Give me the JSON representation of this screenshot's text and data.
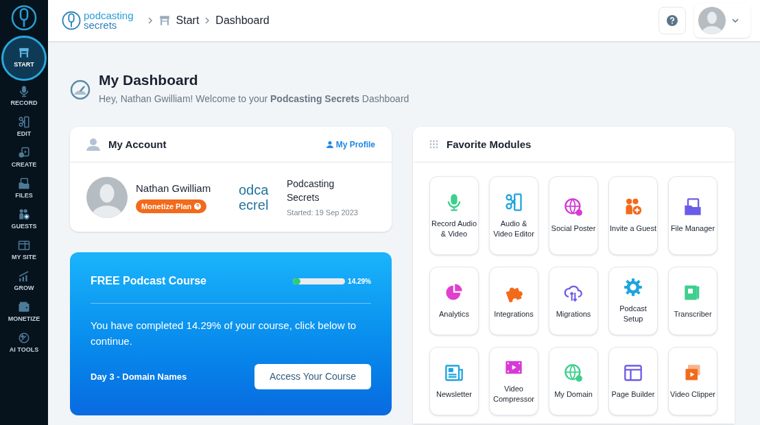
{
  "sidebar": {
    "items": [
      {
        "label": "START",
        "kind": "start",
        "selected": true
      },
      {
        "label": "RECORD",
        "kind": "mic",
        "selected": false
      },
      {
        "label": "EDIT",
        "kind": "edit",
        "selected": false
      },
      {
        "label": "CREATE",
        "kind": "create",
        "selected": false
      },
      {
        "label": "FILES",
        "kind": "files",
        "selected": false
      },
      {
        "label": "GUESTS",
        "kind": "guests",
        "selected": false
      },
      {
        "label": "MY SITE",
        "kind": "site",
        "selected": false
      },
      {
        "label": "GROW",
        "kind": "grow",
        "selected": false
      },
      {
        "label": "MONETIZE",
        "kind": "wallet",
        "selected": false
      },
      {
        "label": "AI TOOLS",
        "kind": "ai",
        "selected": false
      }
    ]
  },
  "header": {
    "logo": [
      "podcasting",
      "secrets"
    ],
    "breadcrumbs": [
      "Start",
      "Dashboard"
    ]
  },
  "page": {
    "title": "My Dashboard",
    "subtitle": "Hey, Nathan Gwilliam! Welcome to your **Podcasting Secrets** Dashboard"
  },
  "account": {
    "title": "My Account",
    "profile_link": "My Profile",
    "name": "Nathan Gwilliam",
    "plan": "Monetize Plan",
    "cover_text": [
      "odca",
      "ecrel"
    ],
    "podcast": "Podcasting Secrets",
    "started": "Started: 19 Sep 2023"
  },
  "course": {
    "title": "FREE Podcast Course",
    "level": 0.1429,
    "reading": "14.29%",
    "message": "You have completed 14.29% of your course, click below to continue.",
    "lesson": "Day 3 - Domain Names",
    "button": "Access Your Course"
  },
  "favorites": {
    "title": "Favorite Modules",
    "modules": [
      {
        "label": "Record Audio & Video",
        "kind": "mic",
        "color": "#3ecf8e"
      },
      {
        "label": "Audio & Video Editor",
        "kind": "edit",
        "color": "#1ea4e0"
      },
      {
        "label": "Social Poster",
        "kind": "globe",
        "color": "#d63ad6"
      },
      {
        "label": "Invite a Guest",
        "kind": "guests",
        "color": "#f26a1b"
      },
      {
        "label": "File Manager",
        "kind": "files",
        "color": "#6b5ce7"
      },
      {
        "label": "Analytics",
        "kind": "pie",
        "color": "#e23fd0"
      },
      {
        "label": "Integrations",
        "kind": "puzzle",
        "color": "#f26a1b"
      },
      {
        "label": "Migrations",
        "kind": "cloud",
        "color": "#6b5ce7"
      },
      {
        "label": "Podcast Setup",
        "kind": "gear",
        "color": "#1ea4e0"
      },
      {
        "label": "Transcriber",
        "kind": "notebook",
        "color": "#3ecf8e"
      },
      {
        "label": "Newsletter",
        "kind": "news",
        "color": "#1ea4e0"
      },
      {
        "label": "Video Compressor",
        "kind": "film",
        "color": "#d63ad6"
      },
      {
        "label": "My Domain",
        "kind": "globe",
        "color": "#3ecf8e"
      },
      {
        "label": "Page Builder",
        "kind": "layout",
        "color": "#6b5ce7"
      },
      {
        "label": "Video Clipper",
        "kind": "clips",
        "color": "#f26a1b"
      }
    ]
  }
}
